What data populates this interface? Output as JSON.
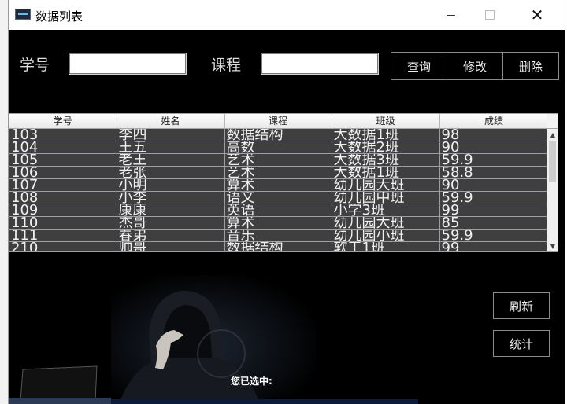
{
  "window": {
    "title": "数据列表"
  },
  "search": {
    "id_label": "学号",
    "id_value": "",
    "course_label": "课程",
    "course_value": ""
  },
  "actions": {
    "query": "查询",
    "modify": "修改",
    "delete": "删除",
    "refresh": "刷新",
    "stats": "统计"
  },
  "table": {
    "columns": [
      "学号",
      "姓名",
      "课程",
      "班级",
      "成绩"
    ],
    "rows": [
      [
        "103",
        "李四",
        "数据结构",
        "大数据1班",
        "98"
      ],
      [
        "104",
        "王五",
        "高数",
        "大数据2班",
        "90"
      ],
      [
        "105",
        "老王",
        "艺术",
        "大数据3班",
        "59.9"
      ],
      [
        "106",
        "老张",
        "艺术",
        "大数据1班",
        "58.8"
      ],
      [
        "107",
        "小明",
        "算术",
        "幼儿园大班",
        "90"
      ],
      [
        "108",
        "小李",
        "语文",
        "幼儿园中班",
        "59.9"
      ],
      [
        "109",
        "康康",
        "英语",
        "小学3班",
        "99"
      ],
      [
        "110",
        "杰哥",
        "算术",
        "幼儿园大班",
        "85"
      ],
      [
        "111",
        "春弟",
        "音乐",
        "幼儿园小班",
        "59.9"
      ],
      [
        "210",
        "帅哥",
        "数据结构",
        "软工1班",
        "99"
      ]
    ]
  },
  "status": {
    "selected": "您已选中:"
  },
  "icons": [
    "app-icon",
    "minimize-icon",
    "maximize-icon",
    "close-icon",
    "scroll-up-icon",
    "scroll-down-icon"
  ]
}
